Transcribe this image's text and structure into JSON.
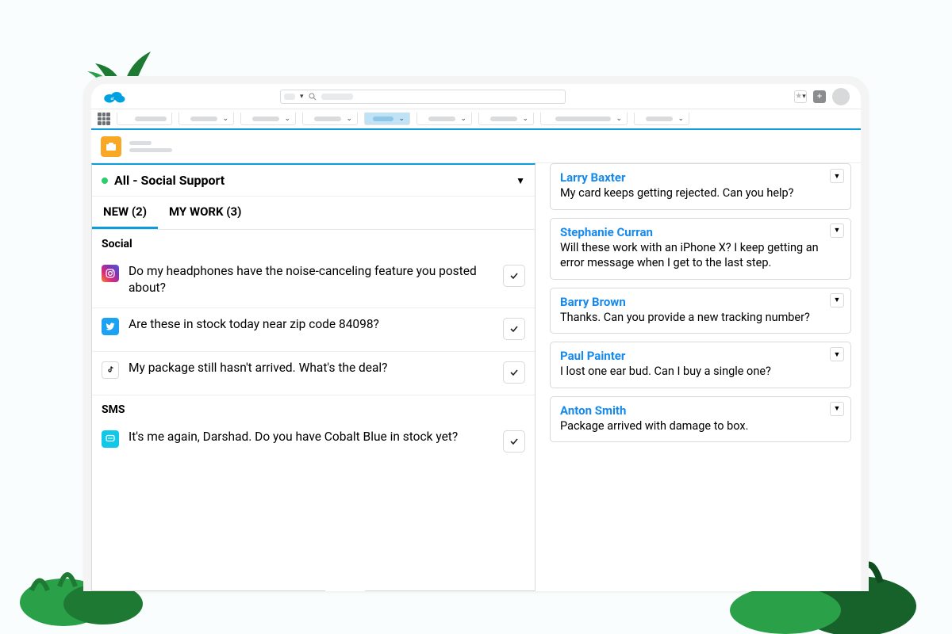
{
  "queue": {
    "title": "All - Social Support",
    "tabs": {
      "new": "NEW (2)",
      "mywork": "MY WORK (3)"
    }
  },
  "groups": {
    "social": "Social",
    "sms": "SMS"
  },
  "messages": {
    "ig": "Do my headphones have the noise-canceling feature you posted about?",
    "tw": "Are these in stock today near zip code 84098?",
    "tt": "My package still hasn't arrived. What's the deal?",
    "sms": "It's me again, Darshad. Do you have Cobalt Blue in stock yet?"
  },
  "cases": [
    {
      "name": "Larry Baxter",
      "msg": "My card keeps getting rejected. Can you help?"
    },
    {
      "name": "Stephanie Curran",
      "msg": "Will these work with an iPhone X? I keep getting an error message when I get to the last step."
    },
    {
      "name": "Barry Brown",
      "msg": "Thanks. Can you provide a new tracking number?"
    },
    {
      "name": "Paul Painter",
      "msg": "I lost one ear bud. Can I buy a single one?"
    },
    {
      "name": "Anton Smith",
      "msg": "Package arrived with damage to box."
    }
  ],
  "icons": {
    "instagram": "instagram-icon",
    "twitter": "twitter-icon",
    "tiktok": "tiktok-icon",
    "sms": "sms-icon"
  }
}
